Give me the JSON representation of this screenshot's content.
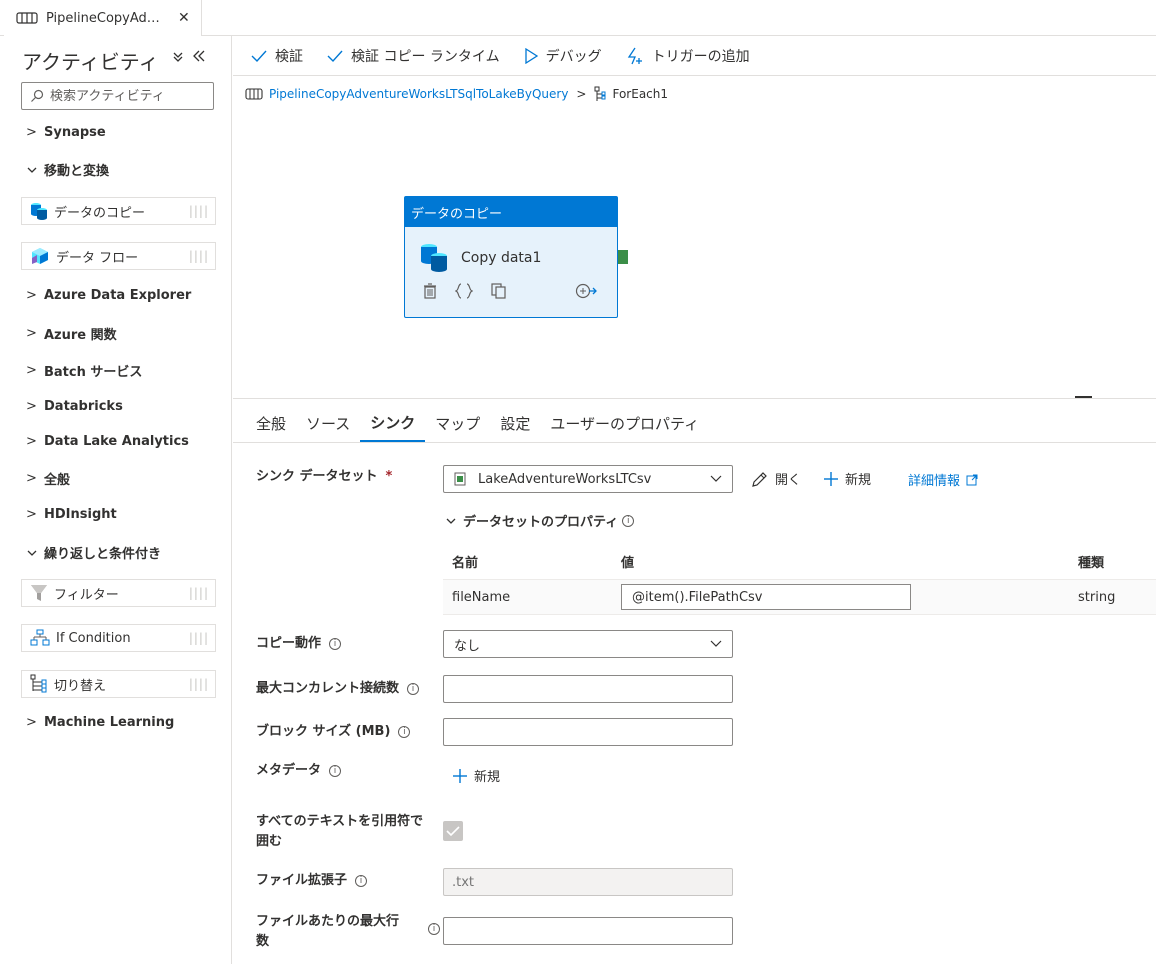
{
  "tab": {
    "title": "PipelineCopyAdventureWorksLTSqlToLakeByQuery",
    "close_glyph": "✕"
  },
  "sidebar": {
    "title": "アクティビティ",
    "search_placeholder": "検索アクティビティ",
    "categories": [
      {
        "label": "Synapse",
        "expanded": false
      },
      {
        "label": "移動と変換",
        "expanded": true
      },
      {
        "label": "Azure Data Explorer",
        "expanded": false
      },
      {
        "label": "Azure 関数",
        "expanded": false
      },
      {
        "label": "Batch サービス",
        "expanded": false
      },
      {
        "label": "Databricks",
        "expanded": false
      },
      {
        "label": "Data Lake Analytics",
        "expanded": false
      },
      {
        "label": "全般",
        "expanded": false
      },
      {
        "label": "HDInsight",
        "expanded": false
      },
      {
        "label": "繰り返しと条件付き",
        "expanded": true
      },
      {
        "label": "Machine Learning",
        "expanded": false
      }
    ],
    "activities": [
      {
        "label": "データのコピー",
        "icon": "copy-data-icon"
      },
      {
        "label": "データ フロー",
        "icon": "data-flow-icon"
      },
      {
        "label": "フィルター",
        "icon": "filter-icon"
      },
      {
        "label": "If Condition",
        "icon": "if-condition-icon"
      },
      {
        "label": "切り替え",
        "icon": "switch-icon"
      }
    ]
  },
  "toolbar": {
    "validate": "検証",
    "validate_copy_runtime": "検証 コピー ランタイム",
    "debug": "デバッグ",
    "add_trigger": "トリガーの追加"
  },
  "breadcrumb": {
    "pipeline": "PipelineCopyAdventureWorksLTSqlToLakeByQuery",
    "separator": ">",
    "current": "ForEach1"
  },
  "node": {
    "header": "データのコピー",
    "name": "Copy data1"
  },
  "properties": {
    "tabs": [
      "全般",
      "ソース",
      "シンク",
      "マップ",
      "設定",
      "ユーザーのプロパティ"
    ],
    "active_tab": "シンク",
    "sink_dataset_label": "シンク データセット",
    "required_mark": "*",
    "sink_dataset_value": "LakeAdventureWorksLTCsv",
    "open_label": "開く",
    "new_label": "新規",
    "details_label": "詳細情報",
    "dataset_props_label": "データセットのプロパティ",
    "table": {
      "headers": {
        "name": "名前",
        "value": "値",
        "type": "種類"
      },
      "rows": [
        {
          "name": "fileName",
          "value": "@item().FilePathCsv",
          "type": "string"
        }
      ]
    },
    "copy_behavior_label": "コピー動作",
    "copy_behavior_value": "なし",
    "max_concurrent_label": "最大コンカレント接続数",
    "block_size_label": "ブロック サイズ (MB)",
    "metadata_label": "メタデータ",
    "metadata_new": "新規",
    "quote_all_label_1": "すべてのテキストを引用符で",
    "quote_all_label_2": "囲む",
    "quote_all_checked": true,
    "file_ext_label": "ファイル拡張子",
    "file_ext_placeholder": ".txt",
    "max_rows_label_1": "ファイルあたりの最大行",
    "max_rows_label_2": "数"
  },
  "colors": {
    "accent": "#0078d4",
    "output_port": "#3b8e48",
    "node_bg": "#e6f2fb"
  }
}
